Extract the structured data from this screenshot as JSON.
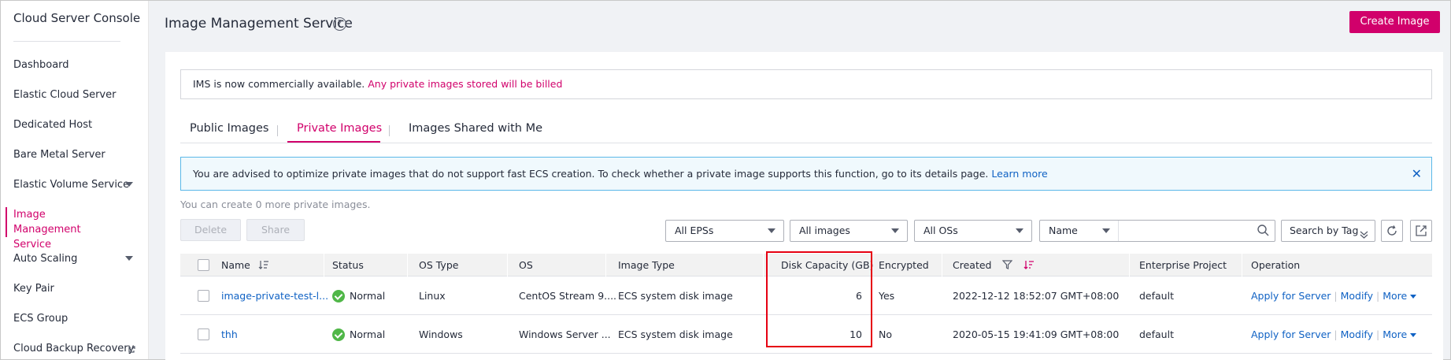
{
  "sidebar": {
    "title": "Cloud Server Console",
    "items": [
      {
        "label": "Dashboard"
      },
      {
        "label": "Elastic Cloud Server"
      },
      {
        "label": "Dedicated Host"
      },
      {
        "label": "Bare Metal Server"
      },
      {
        "label": "Elastic Volume Service"
      },
      {
        "label": "Image Management Service"
      },
      {
        "label": "Auto Scaling"
      },
      {
        "label": "Key Pair"
      },
      {
        "label": "ECS Group"
      },
      {
        "label": "Cloud Backup Recovery"
      }
    ]
  },
  "header": {
    "title": "Image Management Service",
    "help_icon": "?",
    "create_button": "Create Image"
  },
  "notice": {
    "text": "IMS is now commercially available.",
    "warning": "Any private images stored will be billed"
  },
  "tabs": [
    {
      "label": "Public Images"
    },
    {
      "label": "Private Images"
    },
    {
      "label": "Images Shared with Me"
    }
  ],
  "info_banner": {
    "text": "You are advised to optimize private images that do not support fast ECS creation. To check whether a private image supports this function, go to its details page.",
    "link": "Learn more",
    "close_icon": "✕"
  },
  "quota": "You can create 0 more private images.",
  "toolbar": {
    "delete": "Delete",
    "share": "Share",
    "eps_filter": "All EPSs",
    "images_filter": "All images",
    "os_filter": "All OSs",
    "search_field": "Name",
    "search_placeholder": "",
    "tag_search": "Search by Tag"
  },
  "table": {
    "columns": [
      "Name",
      "Status",
      "OS Type",
      "OS",
      "Image Type",
      "Disk Capacity (GB)",
      "Encrypted",
      "Created",
      "Enterprise Project",
      "Operation"
    ],
    "rows": [
      {
        "name": "image-private-test-l...",
        "status": "Normal",
        "os_type": "Linux",
        "os": "CentOS Stream 9....",
        "image_type": "ECS system disk image",
        "disk_capacity": "6",
        "encrypted": "Yes",
        "created": "2022-12-12 18:52:07 GMT+08:00",
        "enterprise_project": "default",
        "op_apply": "Apply for Server",
        "op_modify": "Modify",
        "op_more": "More"
      },
      {
        "name": "thh",
        "status": "Normal",
        "os_type": "Windows",
        "os": "Windows Server ...",
        "image_type": "ECS system disk image",
        "disk_capacity": "10",
        "encrypted": "No",
        "created": "2020-05-15 19:41:09 GMT+08:00",
        "enterprise_project": "default",
        "op_apply": "Apply for Server",
        "op_modify": "Modify",
        "op_more": "More"
      }
    ]
  },
  "colors": {
    "accent": "#d1006b",
    "link": "#1062c4",
    "highlight_box": "#e60012",
    "status_ok": "#50b748"
  }
}
